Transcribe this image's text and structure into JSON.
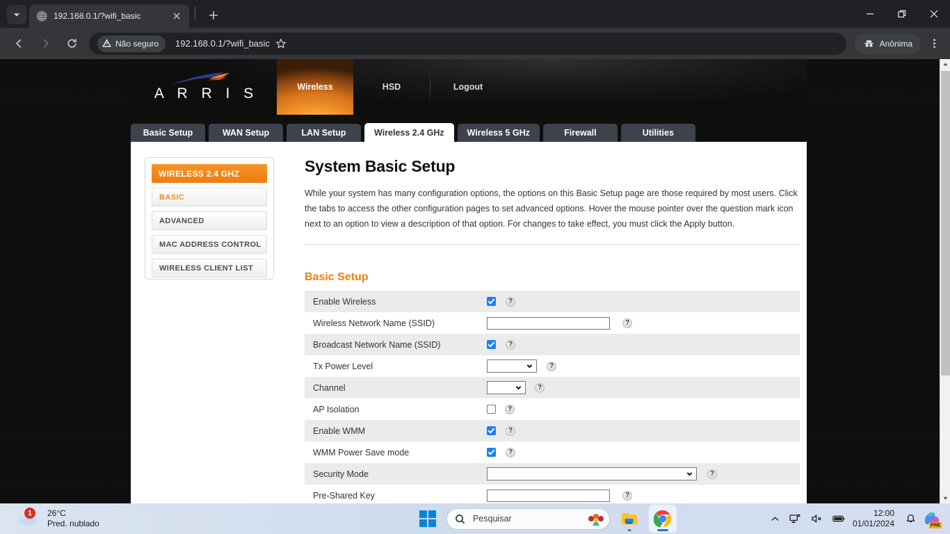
{
  "browser": {
    "tab": {
      "title": "192.168.0.1/?wifi_basic",
      "favicon": "globe-icon",
      "close": "close-icon"
    },
    "new_tab_label": "+",
    "window_controls": {
      "minimize": "minimize-icon",
      "restore": "restore-icon",
      "close": "close-icon"
    },
    "omnibox": {
      "security_label": "Não seguro",
      "url": "192.168.0.1/?wifi_basic"
    },
    "incognito_label": "Anônima",
    "back": "back-arrow-icon",
    "forward": "forward-arrow-icon",
    "reload": "reload-icon",
    "bookmark": "star-icon",
    "menu": "three-dot-menu-icon"
  },
  "site": {
    "brand": "A R R I S",
    "top_nav": [
      {
        "label": "Wireless",
        "active": true
      },
      {
        "label": "HSD",
        "active": false
      },
      {
        "label": "Logout",
        "active": false
      }
    ],
    "tabs": [
      {
        "label": "Basic Setup",
        "active": false
      },
      {
        "label": "WAN Setup",
        "active": false
      },
      {
        "label": "LAN Setup",
        "active": false
      },
      {
        "label": "Wireless 2.4 GHz",
        "active": true
      },
      {
        "label": "Wireless 5 GHz",
        "active": false
      },
      {
        "label": "Firewall",
        "active": false
      },
      {
        "label": "Utilities",
        "active": false
      }
    ],
    "sidebar": {
      "title": "WIRELESS 2.4 GHZ",
      "items": [
        {
          "label": "BASIC",
          "active": true
        },
        {
          "label": "ADVANCED",
          "active": false
        },
        {
          "label": "MAC ADDRESS CONTROL",
          "active": false
        },
        {
          "label": "WIRELESS CLIENT LIST",
          "active": false
        }
      ]
    },
    "page_title": "System Basic Setup",
    "intro": "While your system has many configuration options, the options on this Basic Setup page are those required by most users. Click the tabs to access the other configuration pages to set advanced options. Hover the mouse pointer over the question mark icon next to an option to view a description of that option. For changes to take effect, you must click the Apply button.",
    "section_title": "Basic Setup",
    "help_glyph": "?",
    "accent_color": "#f07d10",
    "rows": [
      {
        "label": "Enable Wireless",
        "type": "checkbox",
        "value": "checked",
        "alt": true
      },
      {
        "label": "Wireless Network Name (SSID)",
        "type": "text",
        "value": "",
        "alt": false
      },
      {
        "label": "Broadcast Network Name (SSID)",
        "type": "checkbox",
        "value": "checked",
        "alt": true
      },
      {
        "label": "Tx Power Level",
        "type": "select",
        "value": "",
        "alt": false
      },
      {
        "label": "Channel",
        "type": "select",
        "value": "",
        "alt": true
      },
      {
        "label": "AP Isolation",
        "type": "checkbox",
        "value": "unchecked",
        "alt": false
      },
      {
        "label": "Enable WMM",
        "type": "checkbox",
        "value": "checked",
        "alt": true
      },
      {
        "label": "WMM Power Save mode",
        "type": "checkbox",
        "value": "checked",
        "alt": false
      },
      {
        "label": "Security Mode",
        "type": "select",
        "value": "",
        "alt": true
      },
      {
        "label": "Pre-Shared Key",
        "type": "text",
        "value": "",
        "alt": false
      }
    ]
  },
  "taskbar": {
    "weather": {
      "temperature": "26°C",
      "condition": "Pred. nublado",
      "badge": "1"
    },
    "start": "windows-start-icon",
    "search": {
      "placeholder": "Pesquisar",
      "icon": "search-icon"
    },
    "apps": [
      {
        "name": "file-explorer",
        "active": false
      },
      {
        "name": "google-chrome",
        "active": true
      }
    ],
    "tray": {
      "overflow": "chevron-up-icon",
      "network": "network-icon",
      "volume": "volume-muted-icon",
      "battery": "battery-icon",
      "time": "12:00",
      "date": "01/01/2024",
      "notifications": "bell-icon",
      "copilot": "copilot-icon",
      "copilot_badge": "PRE"
    }
  }
}
